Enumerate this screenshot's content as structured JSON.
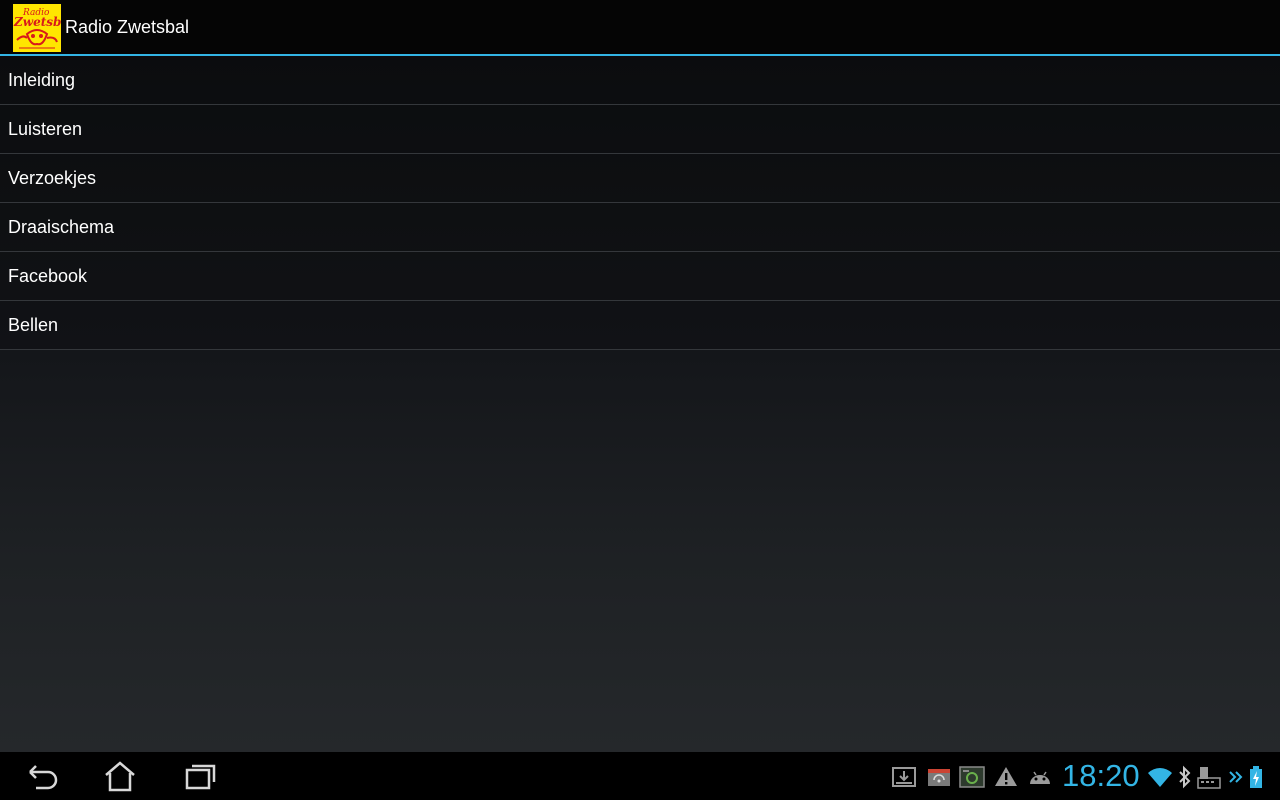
{
  "actionbar": {
    "title": "Radio Zwetsbal",
    "logo_text_top": "Radio",
    "logo_text_main": "Zwetsbal"
  },
  "menu": {
    "items": [
      {
        "label": "Inleiding"
      },
      {
        "label": "Luisteren"
      },
      {
        "label": "Verzoekjes"
      },
      {
        "label": "Draaischema"
      },
      {
        "label": "Facebook"
      },
      {
        "label": "Bellen"
      }
    ]
  },
  "statusbar": {
    "time": "18:20",
    "icons": [
      "download-icon",
      "radio-icon",
      "screenshot-icon",
      "warning-icon",
      "android-icon",
      "wifi-icon",
      "bluetooth-icon",
      "keyboard-icon",
      "chevron-icon",
      "battery-icon"
    ]
  },
  "colors": {
    "accent": "#33b5e5",
    "logo_bg": "#ffe600",
    "logo_text": "#d81b1b"
  }
}
